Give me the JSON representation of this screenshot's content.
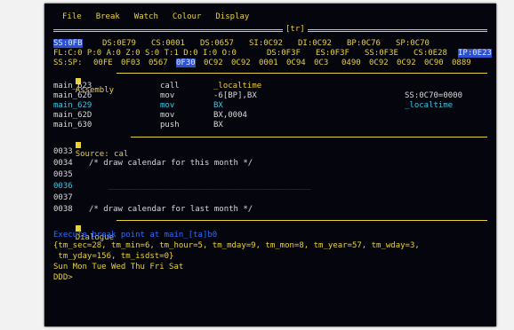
{
  "menu": [
    "File",
    "Break",
    "Watch",
    "Colour",
    "Display"
  ],
  "window_tag": "[tr]",
  "registers": {
    "line1": [
      "SS:0FB",
      "DS:0E79",
      "CS:0001",
      "DS:0657",
      "SI:0C92",
      "DI:0C92",
      "BP:0C76",
      "SP:0C70"
    ],
    "line2": [
      "FL:C:0 P:0 A:0 Z:0 S:0 T:1 D:0 I:0 O:0",
      "DS:0F3F",
      "ES:0F3F",
      "SS:0F3E",
      "CS:0E28",
      "IP:0E23"
    ],
    "line3": [
      "SS:SP:",
      "00FE",
      "0F03",
      "0567",
      "0F30",
      "0C92",
      "0C92",
      "0001",
      "0C94",
      "0C3",
      "0490",
      "0C92",
      "0C92",
      "0C90",
      "0889"
    ]
  },
  "assembly": {
    "label": "Assembly",
    "rows": [
      {
        "addr": "main_623",
        "op": "call",
        "arg": "_localtime",
        "extra": ""
      },
      {
        "addr": "main_626",
        "op": "mov",
        "arg": "-6[BP],BX",
        "extra": "SS:0C70=0000"
      },
      {
        "addr": "main_629",
        "op": "mov",
        "arg": "BX",
        "extra": "_localtime"
      },
      {
        "addr": "main_62D",
        "op": "mov",
        "arg": "BX,0004",
        "extra": ""
      },
      {
        "addr": "main_630",
        "op": "push",
        "arg": "BX",
        "extra": ""
      }
    ]
  },
  "source": {
    "label": "Source: cal",
    "rows": [
      {
        "num": "0033",
        "text": ""
      },
      {
        "num": "0034",
        "text": "/* draw calendar for this month */"
      },
      {
        "num": "0035",
        "text": ""
      },
      {
        "num": "0036",
        "text": "    __________________________________________"
      },
      {
        "num": "0037",
        "text": ""
      },
      {
        "num": "0038",
        "text": "/* draw calendar for last month */"
      }
    ]
  },
  "dialogue": {
    "label": "Dialogue",
    "lines": [
      "Execute break point at main_[ta]b0",
      "{tm_sec=28, tm_min=6, tm_hour=5, tm_mday=9, tm_mon=8, tm_year=57, tm_wday=3,",
      " tm_yday=156, tm_isdst=0}",
      "Sun Mon Tue Wed Thu Fri Sat"
    ],
    "prompt": "DDD>"
  },
  "colors": {
    "bg": "#05050d",
    "yellow": "#e8d23a",
    "blue_highlight": "#2a52d0",
    "cyan": "#38c7e0"
  }
}
